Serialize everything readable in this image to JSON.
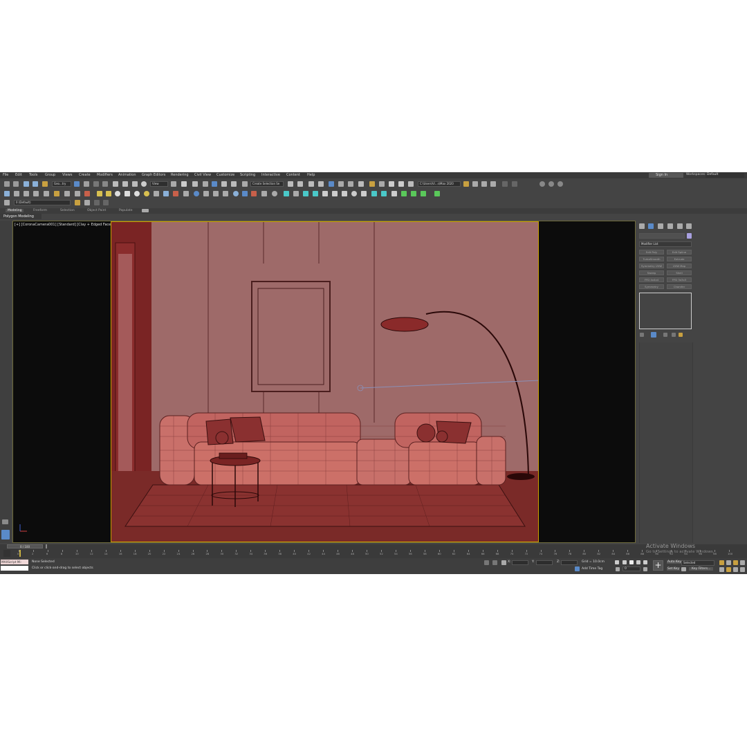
{
  "menu": [
    "File",
    "Edit",
    "Tools",
    "Group",
    "Views",
    "Create",
    "Modifiers",
    "Animation",
    "Graph Editors",
    "Rendering",
    "Civil View",
    "Customize",
    "Scripting",
    "Interactive",
    "Content",
    "Help"
  ],
  "header": {
    "sign_in": "Sign In",
    "workspaces_label": "Workspaces:",
    "workspace_value": "Default"
  },
  "toolbar": {
    "selection_filter": "Geo...try",
    "reference_coord": "View",
    "selection_set": "Create Selection Se",
    "project_path": "C:\\Users\\Vi...s\\Max 2020",
    "layer": "0 (Default)"
  },
  "ribbon": {
    "tabs": [
      "Modeling",
      "Freeform",
      "Selection",
      "Object Paint",
      "Populate"
    ],
    "active_tab": "Modeling",
    "panel": "Polygon Modeling"
  },
  "viewport": {
    "label": "[+] [CoronaCamera001] [Standard] [Clay + Edged Faces]"
  },
  "command_panel": {
    "modifier_list": "Modifier List",
    "buttons": [
      "Edit Poly",
      "Edit Spline",
      "TurboSmooth",
      "Extrude",
      "Symmetry UVW",
      "UVW Map",
      "Sweep",
      "Shell",
      "FFD 4x4x4",
      "FFD 3x3x3",
      "Symmetry",
      "Chamfer"
    ]
  },
  "timeline": {
    "frame_counter": "0 / 100",
    "ticks": [
      "0",
      "2",
      "6",
      "8",
      "10",
      "12",
      "14",
      "16",
      "18",
      "20",
      "22",
      "24",
      "26",
      "28",
      "30",
      "32",
      "34",
      "36",
      "38",
      "40",
      "42",
      "44",
      "46",
      "48",
      "50",
      "52",
      "54",
      "56",
      "58",
      "60",
      "62",
      "64",
      "66",
      "68",
      "70",
      "72",
      "74",
      "76",
      "78",
      "80",
      "82",
      "84",
      "86",
      "88",
      "90",
      "92",
      "94",
      "96",
      "98",
      "100"
    ]
  },
  "status": {
    "maxscript": "MAXScript Mi:",
    "selection": "None Selected",
    "prompt": "Click or click-and-drag to select objects",
    "x_label": "X:",
    "y_label": "Y:",
    "z_label": "Z:",
    "grid": "Grid = 10.0cm",
    "add_time_tag": "Add Time Tag",
    "auto_key": "Auto Key",
    "set_key": "Set Key",
    "selected": "Selected",
    "key_filters": "Key Filters...",
    "frame": "0"
  },
  "watermark": {
    "title": "Activate Windows",
    "subtitle": "Go to Settings to activate Windows."
  }
}
